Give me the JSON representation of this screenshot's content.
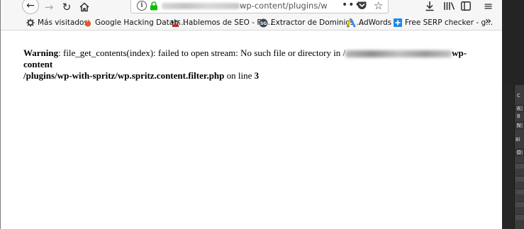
{
  "toolbar": {
    "url_visible": "wp-content/plugins/w",
    "more_label": "•••",
    "star_label": "☆",
    "back_label": "←",
    "forward_label": "→",
    "reload_label": "↻",
    "home_label": "⌂",
    "download_label": "⤓",
    "library_label": "|||\\",
    "menu_label": "≡"
  },
  "bookmarks": {
    "items": [
      {
        "label": "Más visitados",
        "icon": "gear-icon"
      },
      {
        "label": "Google Hacking Datab...",
        "icon": "flame-icon"
      },
      {
        "label": "Hablemos de SEO - Fo...",
        "icon": "seo-icon"
      },
      {
        "label": "Extractor de Dominios ...",
        "icon": "sg-icon"
      },
      {
        "label": "AdWords",
        "icon": "adwords-icon"
      },
      {
        "label": "Free SERP checker - g...",
        "icon": "plus-icon"
      }
    ],
    "overflow_label": "»"
  },
  "page": {
    "warning_label": "Warning",
    "message_part1": ": file_get_contents(index): failed to open stream: No such file or directory in /",
    "path_tail": "wp-content",
    "path_line2": "/plugins/wp-with-spritz/wp.spritz.content.filter.php",
    "on_line_text": " on line ",
    "line_number": "3"
  },
  "right_panel": {
    "chars": [
      "C",
      "A",
      "B",
      "N",
      "Bl",
      "O"
    ]
  }
}
